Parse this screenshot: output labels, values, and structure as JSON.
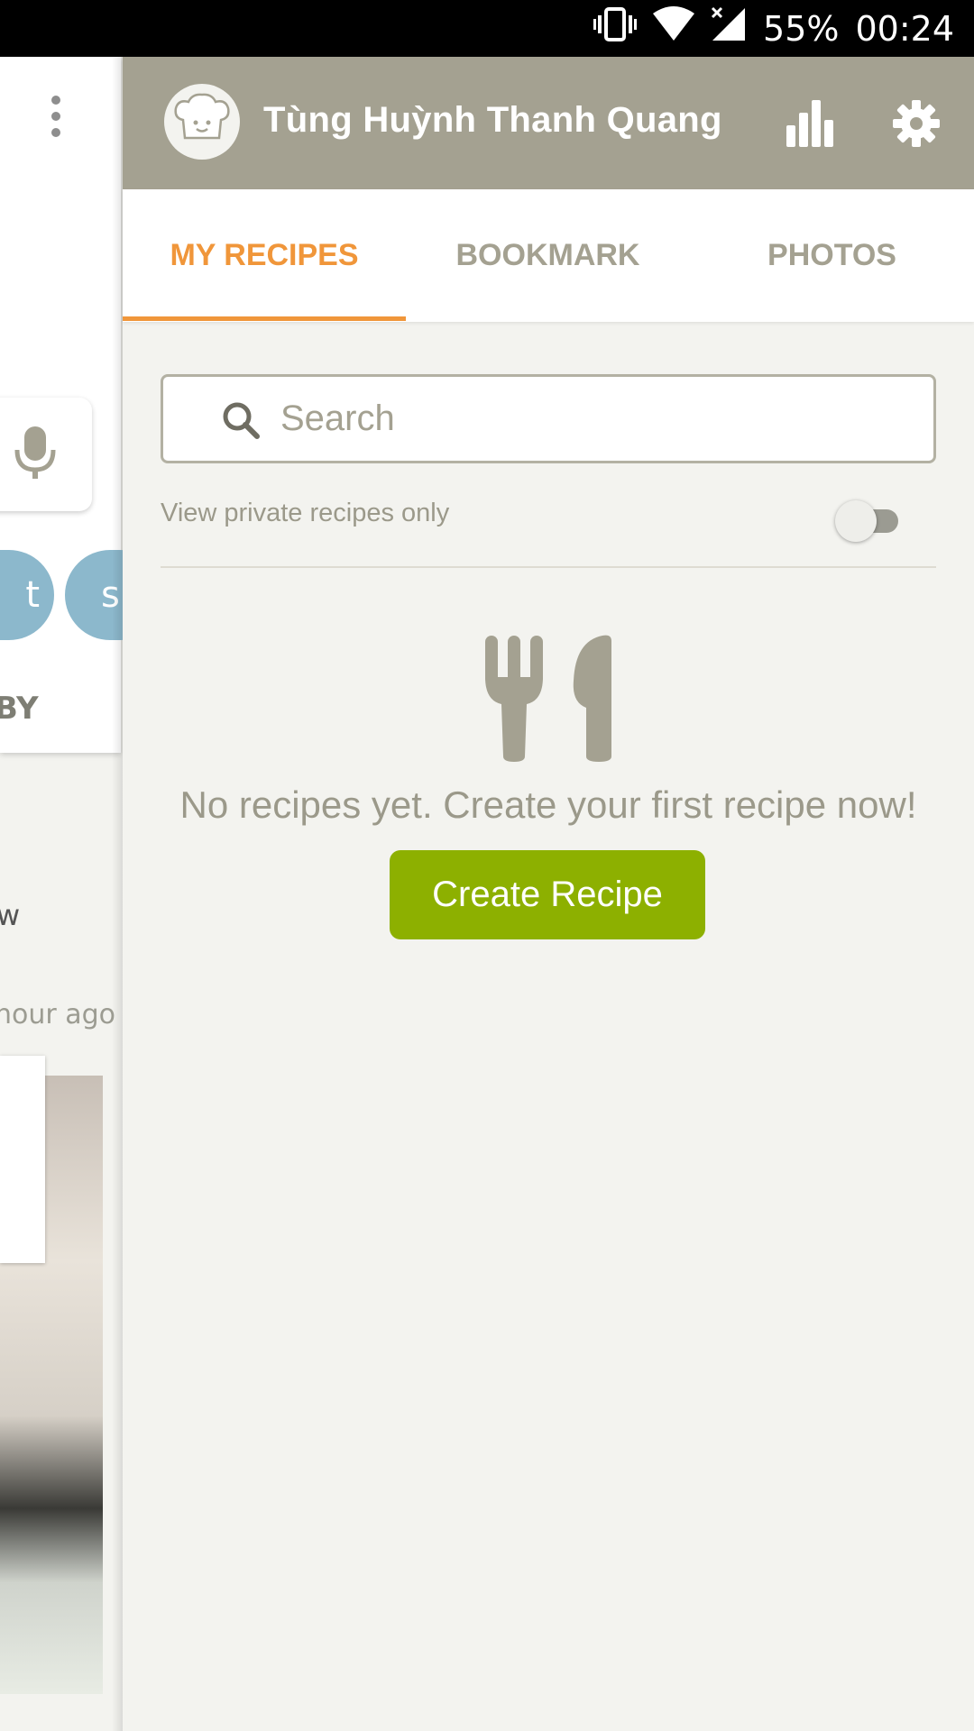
{
  "status_bar": {
    "battery": "55%",
    "time": "00:24",
    "icons": [
      "vibrate-icon",
      "wifi-icon",
      "signal-icon"
    ]
  },
  "background_screen": {
    "label_by": "BY",
    "chip_1": "t",
    "chip_2": "s",
    "text_w": "w",
    "time_ago": "hour ago"
  },
  "drawer": {
    "user_name": "Tùng Huỳnh Thanh Quang",
    "avatar_icon": "chef-hat-icon",
    "tabs": [
      {
        "label": "MY RECIPES",
        "active": true
      },
      {
        "label": "BOOKMARK",
        "active": false
      },
      {
        "label": "PHOTOS",
        "active": false
      }
    ],
    "search": {
      "placeholder": "Search",
      "value": ""
    },
    "private_toggle": {
      "label": "View private recipes only",
      "on": false
    },
    "empty_state": {
      "message": "No recipes yet. Create your first recipe now!",
      "button_label": "Create Recipe"
    }
  },
  "colors": {
    "header_bg": "#a4a191",
    "accent_orange": "#f0963a",
    "button_green": "#8db000",
    "chip_blue": "#8cb8cc"
  }
}
